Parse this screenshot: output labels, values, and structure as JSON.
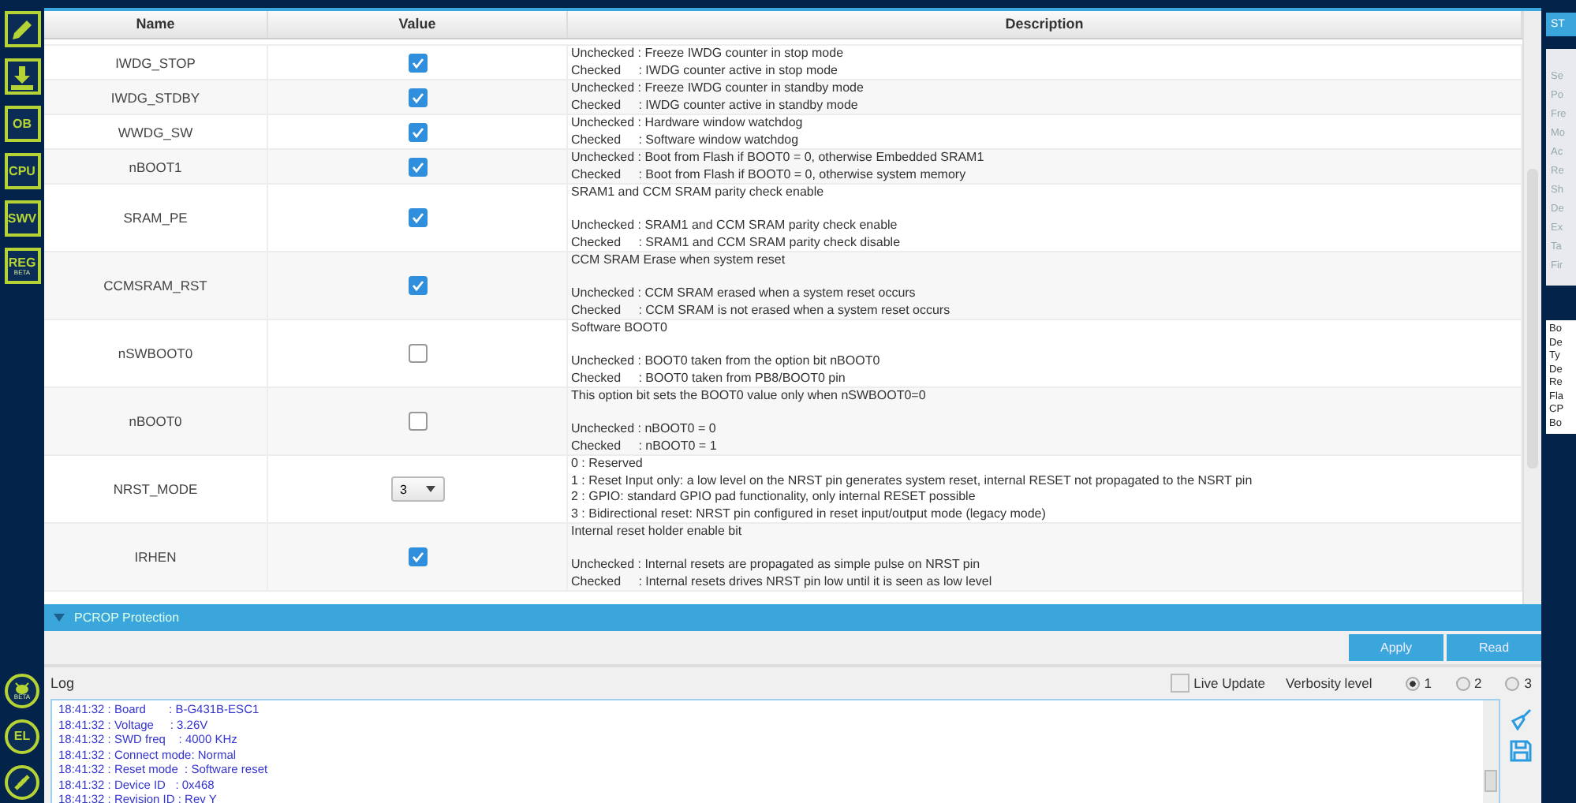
{
  "sidebar": {
    "text_buttons": [
      {
        "label": "OB"
      },
      {
        "label": "CPU"
      },
      {
        "label": "SWV"
      },
      {
        "label": "REG",
        "badge": "BETA"
      }
    ],
    "bottom_badges": [
      {
        "label": "BETA"
      },
      {
        "label": "EL"
      }
    ]
  },
  "table": {
    "columns": [
      "Name",
      "Value",
      "Description"
    ],
    "rows": [
      {
        "name": "IWDG_STOP",
        "value": {
          "kind": "checkbox",
          "checked": true
        },
        "description": {
          "lines": [
            "Unchecked : Freeze IWDG counter in stop mode",
            "Checked     : IWDG counter active in stop mode"
          ]
        }
      },
      {
        "name": "IWDG_STDBY",
        "value": {
          "kind": "checkbox",
          "checked": true
        },
        "description": {
          "lines": [
            "Unchecked : Freeze IWDG counter in standby mode",
            "Checked     : IWDG counter active in standby mode"
          ]
        }
      },
      {
        "name": "WWDG_SW",
        "value": {
          "kind": "checkbox",
          "checked": true
        },
        "description": {
          "lines": [
            "Unchecked : Hardware window watchdog",
            "Checked     : Software window watchdog"
          ]
        }
      },
      {
        "name": "nBOOT1",
        "value": {
          "kind": "checkbox",
          "checked": true
        },
        "description": {
          "lines": [
            "Unchecked : Boot from Flash if BOOT0 = 0, otherwise Embedded SRAM1",
            "Checked     : Boot from Flash if BOOT0 = 0, otherwise system memory"
          ]
        }
      },
      {
        "name": "SRAM_PE",
        "value": {
          "kind": "checkbox",
          "checked": true
        },
        "description": {
          "heading": "SRAM1 and CCM SRAM parity check enable",
          "lines": [
            "Unchecked : SRAM1 and CCM SRAM parity check enable",
            "Checked     : SRAM1 and CCM SRAM parity check disable"
          ]
        }
      },
      {
        "name": "CCMSRAM_RST",
        "value": {
          "kind": "checkbox",
          "checked": true
        },
        "description": {
          "heading": "CCM SRAM Erase when system reset",
          "lines": [
            "Unchecked : CCM SRAM erased when a system reset occurs",
            "Checked     : CCM SRAM is not erased when a system reset occurs"
          ]
        }
      },
      {
        "name": "nSWBOOT0",
        "value": {
          "kind": "checkbox",
          "checked": false
        },
        "description": {
          "heading": "Software BOOT0",
          "lines": [
            "Unchecked : BOOT0 taken from the option bit nBOOT0",
            "Checked     : BOOT0 taken from PB8/BOOT0 pin"
          ]
        }
      },
      {
        "name": "nBOOT0",
        "value": {
          "kind": "checkbox",
          "checked": false
        },
        "description": {
          "heading": "This option bit sets the BOOT0 value only when nSWBOOT0=0",
          "lines": [
            "Unchecked : nBOOT0 = 0",
            "Checked     : nBOOT0 = 1"
          ]
        }
      },
      {
        "name": "NRST_MODE",
        "value": {
          "kind": "dropdown",
          "value": "3"
        },
        "description": {
          "lines": [
            "0 : Reserved",
            "1 : Reset Input only: a low level on the NRST pin generates system reset, internal RESET not propagated to the NSRT pin",
            "2 : GPIO: standard GPIO pad functionality, only internal RESET possible",
            "3 : Bidirectional reset: NRST pin configured in reset input/output mode (legacy mode)"
          ]
        }
      },
      {
        "name": "IRHEN",
        "value": {
          "kind": "checkbox",
          "checked": true
        },
        "description": {
          "heading": "Internal reset holder enable bit",
          "lines": [
            "Unchecked : Internal resets are propagated as simple pulse on NRST pin",
            "Checked     : Internal resets drives NRST pin low until it is seen as low level"
          ]
        }
      }
    ]
  },
  "section": {
    "title": "PCROP Protection",
    "expanded": false
  },
  "buttons": [
    "Apply",
    "Read"
  ],
  "log": {
    "title": "Log",
    "live_update": {
      "label": "Live Update",
      "checked": false
    },
    "verbosity_label": "Verbosity level",
    "verbosity": [
      {
        "label": "1",
        "selected": true
      },
      {
        "label": "2",
        "selected": false
      },
      {
        "label": "3",
        "selected": false
      }
    ],
    "lines": [
      "18:41:32 : Board       : B-G431B-ESC1",
      "18:41:32 : Voltage     : 3.26V",
      "18:41:32 : SWD freq    : 4000 KHz",
      "18:41:32 : Connect mode: Normal",
      "18:41:32 : Reset mode  : Software reset",
      "18:41:32 : Device ID   : 0x468",
      "18:41:32 : Revision ID : Rev Y"
    ]
  },
  "right_panel": {
    "button": "ST",
    "upper_labels": [
      "Se",
      "Po",
      "Fre",
      "Mo",
      "Ac",
      "Re",
      "Sh",
      "De",
      "Ex",
      "Ta",
      "Fir"
    ],
    "lower_labels": [
      "Bo",
      "De",
      "Ty",
      "De",
      "Re",
      "Fla",
      "CP",
      "Bo"
    ]
  }
}
